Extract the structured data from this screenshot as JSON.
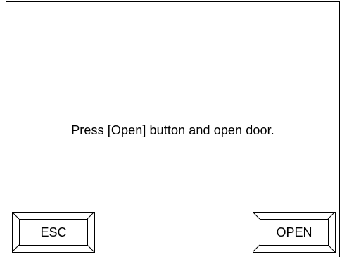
{
  "dialog": {
    "message": "Press [Open] button and open door."
  },
  "buttons": {
    "esc_label": "ESC",
    "open_label": "OPEN"
  }
}
